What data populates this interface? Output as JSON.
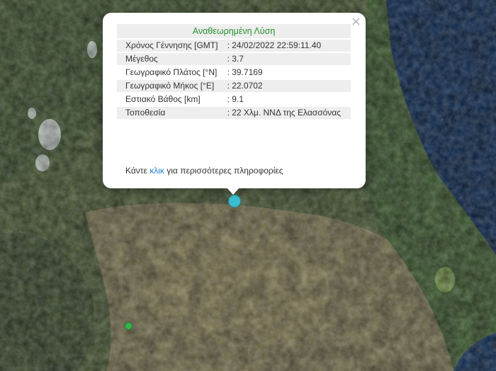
{
  "popup": {
    "title": "Αναθεωρημένη Λύση",
    "close_glyph": "×",
    "rows": [
      {
        "label": "Χρόνος Γέννησης [GMT]",
        "value": ": 24/02/2022 22:59:11.40"
      },
      {
        "label": "Μέγεθος",
        "value": ": 3.7"
      },
      {
        "label": "Γεωγραφικό Πλάτος [°N]",
        "value": ": 39.7169"
      },
      {
        "label": "Γεωγραφικό Μήκος [°E]",
        "value": ": 22.0702"
      },
      {
        "label": "Εστιακό Βάθος [km]",
        "value": ": 9.1"
      },
      {
        "label": "Τοποθεσία",
        "value": ": 22 Χλμ. ΝΝΔ της Ελασσόνας"
      }
    ],
    "more_prefix": "Κάντε",
    "more_link": "κλικ",
    "more_suffix": "για περισσότερες πληροφορίες"
  },
  "markers": {
    "main_color": "#3bbdd0",
    "secondary_color": "#33b54a"
  },
  "colors": {
    "title_green": "#26902b",
    "link_blue": "#1f7fcf",
    "sea": "#0d2a52"
  }
}
